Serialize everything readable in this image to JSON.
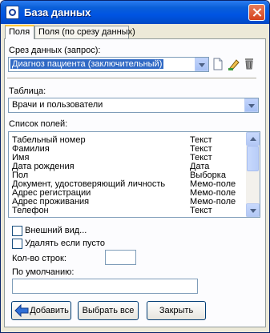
{
  "window": {
    "title": "База данных"
  },
  "tabs": [
    {
      "label": "Поля",
      "active": true
    },
    {
      "label": "Поля (по срезу данных)",
      "active": false
    }
  ],
  "query": {
    "label": "Срез данных (запрос):",
    "value": "Диагноз пациента (заключительный)",
    "toolbar_icons": [
      "new-document-icon",
      "edit-pencil-icon",
      "trash-icon"
    ]
  },
  "table": {
    "label": "Таблица:",
    "value": "Врачи и пользователи"
  },
  "fields": {
    "label": "Список полей:",
    "rows": [
      {
        "name": "Табельный номер",
        "type": "Текст"
      },
      {
        "name": "Фамилия",
        "type": "Текст"
      },
      {
        "name": "Имя",
        "type": "Текст"
      },
      {
        "name": "Дата рождения",
        "type": "Дата"
      },
      {
        "name": "Пол",
        "type": "Выборка"
      },
      {
        "name": "Документ, удостоверяющий личность",
        "type": "Мемо-поле"
      },
      {
        "name": "Адрес регистрации",
        "type": "Мемо-поле"
      },
      {
        "name": "Адрес проживания",
        "type": "Мемо-поле"
      },
      {
        "name": "Телефон",
        "type": "Текст"
      }
    ]
  },
  "options": {
    "appearance_label": "Внешний вид...",
    "appearance_checked": false,
    "delete_if_empty_label": "Удалять если пусто",
    "delete_if_empty_checked": false,
    "rows_count_label": "Кол-во строк:",
    "rows_count_value": "",
    "default_label": "По умолчанию:",
    "default_value": ""
  },
  "buttons": {
    "add": "Добавить",
    "select_all": "Выбрать все",
    "close": "Закрыть"
  },
  "colors": {
    "titlebar": "#0054e3",
    "selection": "#316ac5",
    "dialog_bg": "#ece9d8",
    "active_tab_accent": "#ffc83c"
  }
}
